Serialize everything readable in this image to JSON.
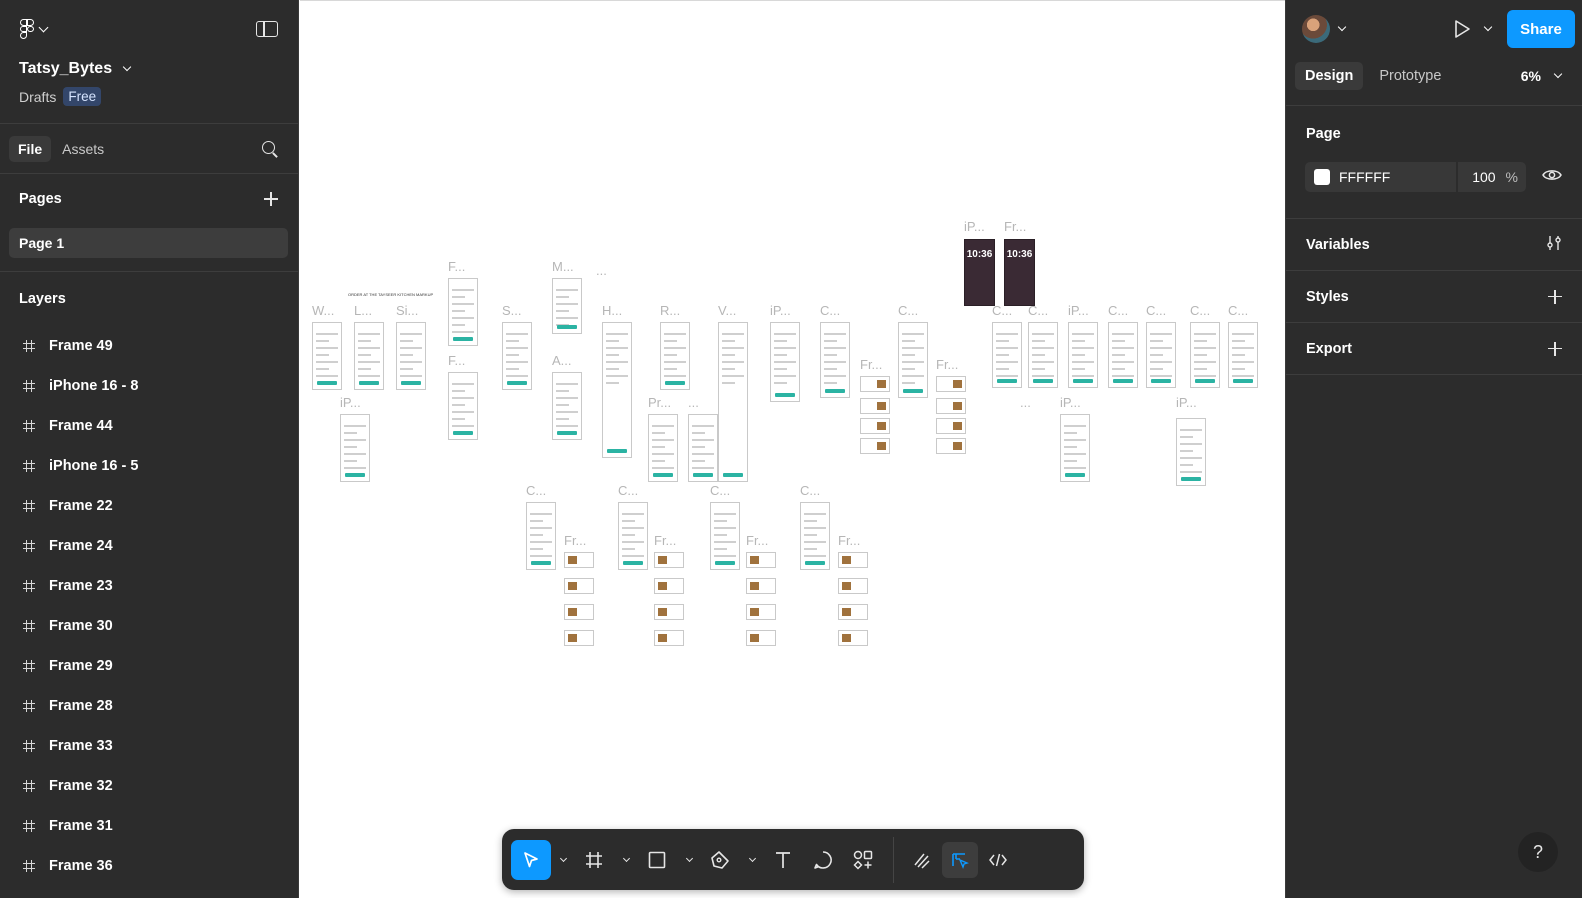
{
  "file": {
    "name": "Tatsy_Bytes",
    "location": "Drafts",
    "plan": "Free"
  },
  "left_tabs": [
    "File",
    "Assets"
  ],
  "pages": {
    "heading": "Pages",
    "items": [
      "Page 1"
    ]
  },
  "layers": {
    "heading": "Layers",
    "items": [
      "Frame 49",
      "iPhone 16 - 8",
      "Frame 44",
      "iPhone 16 - 5",
      "Frame 22",
      "Frame 24",
      "Frame 23",
      "Frame 30",
      "Frame 29",
      "Frame 28",
      "Frame 33",
      "Frame 32",
      "Frame 31",
      "Frame 36"
    ]
  },
  "canvas": {
    "frame_labels": [
      "W...",
      "L...",
      "Si...",
      "F...",
      "F...",
      "S...",
      "M...",
      "...",
      "A...",
      "H...",
      "R...",
      "V...",
      "iP...",
      "C...",
      "C...",
      "Fr...",
      "Fr...",
      "iP...",
      "Fr...",
      "C...",
      "C...",
      "iP...",
      "C...",
      "C...",
      "C...",
      "C...",
      "iP...",
      "Pr...",
      "...",
      "...",
      "iP...",
      "iP...",
      "C...",
      "C...",
      "C...",
      "C...",
      "Fr...",
      "Fr...",
      "Fr...",
      "Fr..."
    ],
    "lock_time": "10:36",
    "frame_heading": "ORDER AT THE TAYSEER KITCHEN MARKUP"
  },
  "right": {
    "share_label": "Share",
    "tabs": [
      "Design",
      "Prototype"
    ],
    "zoom": "6%",
    "page_section": {
      "title": "Page",
      "color": "FFFFFF",
      "opacity": "100",
      "unit": "%"
    },
    "sections": [
      "Variables",
      "Styles",
      "Export"
    ],
    "help": "?"
  },
  "colors": {
    "accent": "#0d99ff",
    "panel": "#2c2c2c",
    "frame_teal": "#2bb3a3"
  }
}
